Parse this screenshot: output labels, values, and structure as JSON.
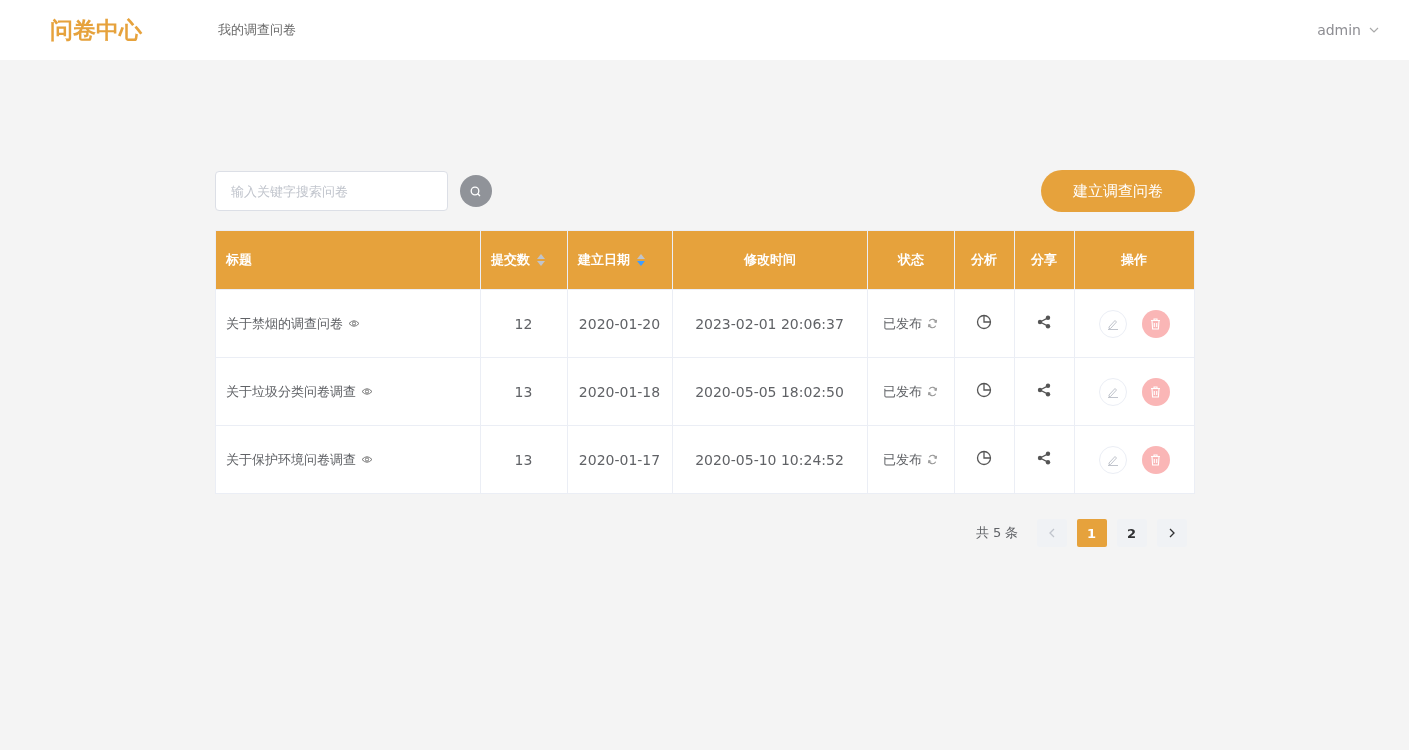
{
  "header": {
    "logo": "问卷中心",
    "nav": [
      {
        "label": "我的调查问卷",
        "selected": false
      }
    ],
    "user": "admin"
  },
  "toolbar": {
    "search": {
      "placeholder": "输入关键字搜索问卷"
    },
    "create_button": "建立调查问卷"
  },
  "table": {
    "columns": [
      {
        "label": "标题"
      },
      {
        "label": "提交数",
        "sorted_descending": false
      },
      {
        "label": "建立日期",
        "sorted_descending": true
      },
      {
        "label": "修改时间"
      },
      {
        "label": "状态"
      },
      {
        "label": "分析"
      },
      {
        "label": "分享"
      },
      {
        "label": "操作"
      }
    ],
    "rows": [
      {
        "title": "关于禁烟的调查问卷",
        "submissions": "12",
        "created": "2020-01-20",
        "modified": "2023-02-01 20:06:37",
        "status": "已发布"
      },
      {
        "title": "关于垃圾分类问卷调查",
        "submissions": "13",
        "created": "2020-01-18",
        "modified": "2020-05-05 18:02:50",
        "status": "已发布"
      },
      {
        "title": "关于保护环境问卷调查",
        "submissions": "13",
        "created": "2020-01-17",
        "modified": "2020-05-10 10:24:52",
        "status": "已发布"
      }
    ]
  },
  "pagination": {
    "total": "共 5 条",
    "prev_disabled": true,
    "next_disabled": false,
    "pages": [
      {
        "label": "1",
        "selected": true
      },
      {
        "label": "2",
        "selected": false
      }
    ]
  }
}
